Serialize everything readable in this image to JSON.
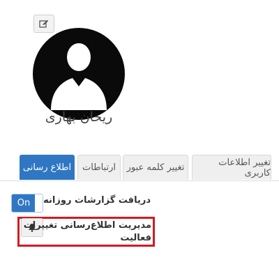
{
  "profile": {
    "name": "ریحان بهاری"
  },
  "tabs": [
    {
      "label": "تغییر اطلاعات کاربری",
      "active": false
    },
    {
      "label": "تغییر کلمه عبور",
      "active": false
    },
    {
      "label": "ارتباطات",
      "active": false
    },
    {
      "label": "اطلاع رسانی",
      "active": true
    }
  ],
  "settings": {
    "daily_reports": {
      "label": "دریافت گزارشات روزانه",
      "toggle_label": "On",
      "enabled": true
    },
    "activity_notifications": {
      "label_line1": "مدیریت اطلاع‌رسانی تغییرات",
      "label_line2": "فعالیت"
    }
  },
  "icons": {
    "edit": "pencil-edit-icon",
    "avatar": "user-silhouette-icon",
    "bell": "bell-icon"
  },
  "colors": {
    "accent": "#2f77c3",
    "avatar_bg": "#0a0a0a",
    "highlight": "#d21a24"
  }
}
